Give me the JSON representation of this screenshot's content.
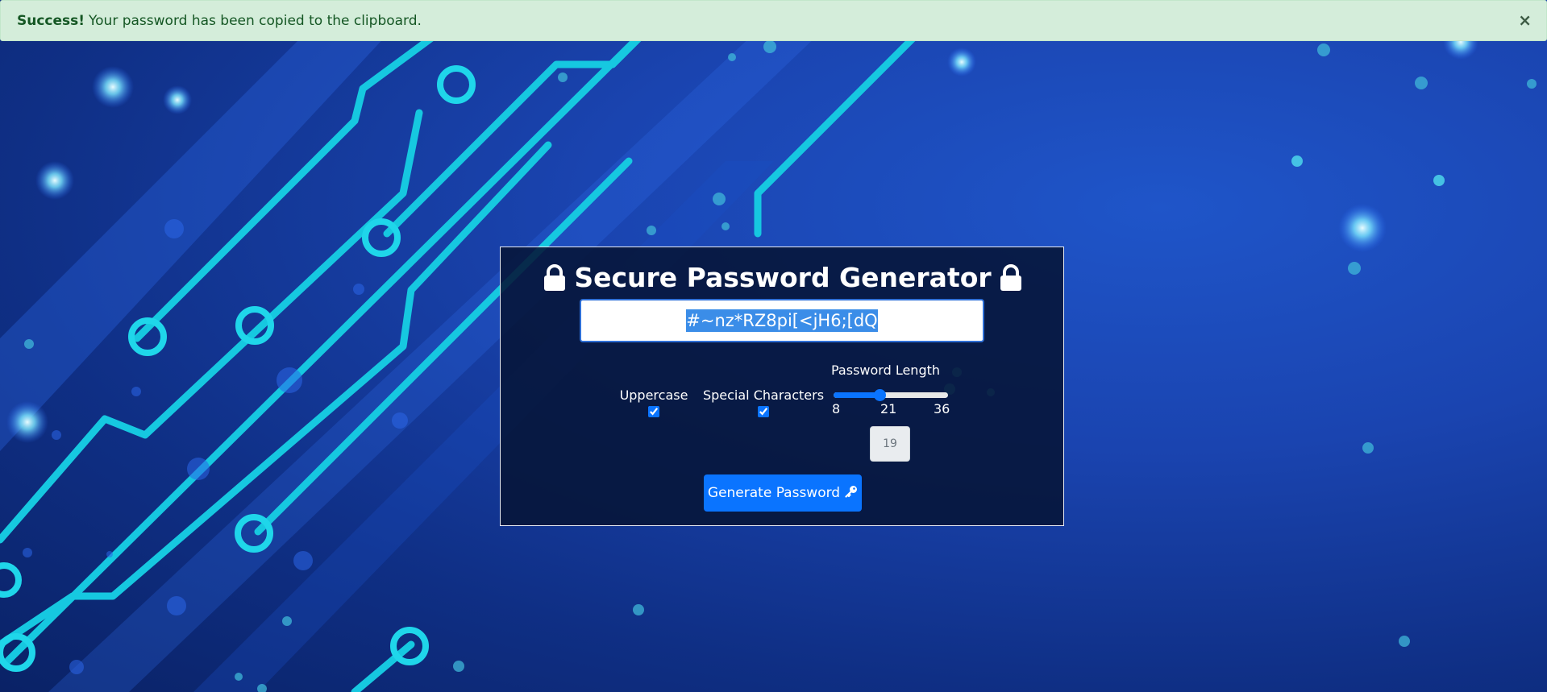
{
  "alert": {
    "strong": "Success!",
    "message": "Your password has been copied to the clipboard.",
    "close": "×"
  },
  "card": {
    "title": "Secure Password Generator",
    "password": "#~nz*RZ8pi[<jH6;[dQ",
    "options": {
      "uppercase_label": "Uppercase",
      "uppercase_checked": true,
      "special_label": "Special Characters",
      "special_checked": true
    },
    "length": {
      "label": "Password Length",
      "min": "8",
      "mid": "21",
      "max": "36",
      "value": "19",
      "fraction": 0.393
    },
    "generate_label": "Generate Password"
  },
  "colors": {
    "accent": "#0a74ff",
    "alert_bg": "#d4edda",
    "alert_text": "#155724"
  },
  "icons": [
    "lock-icon",
    "key-icon",
    "close-icon"
  ]
}
